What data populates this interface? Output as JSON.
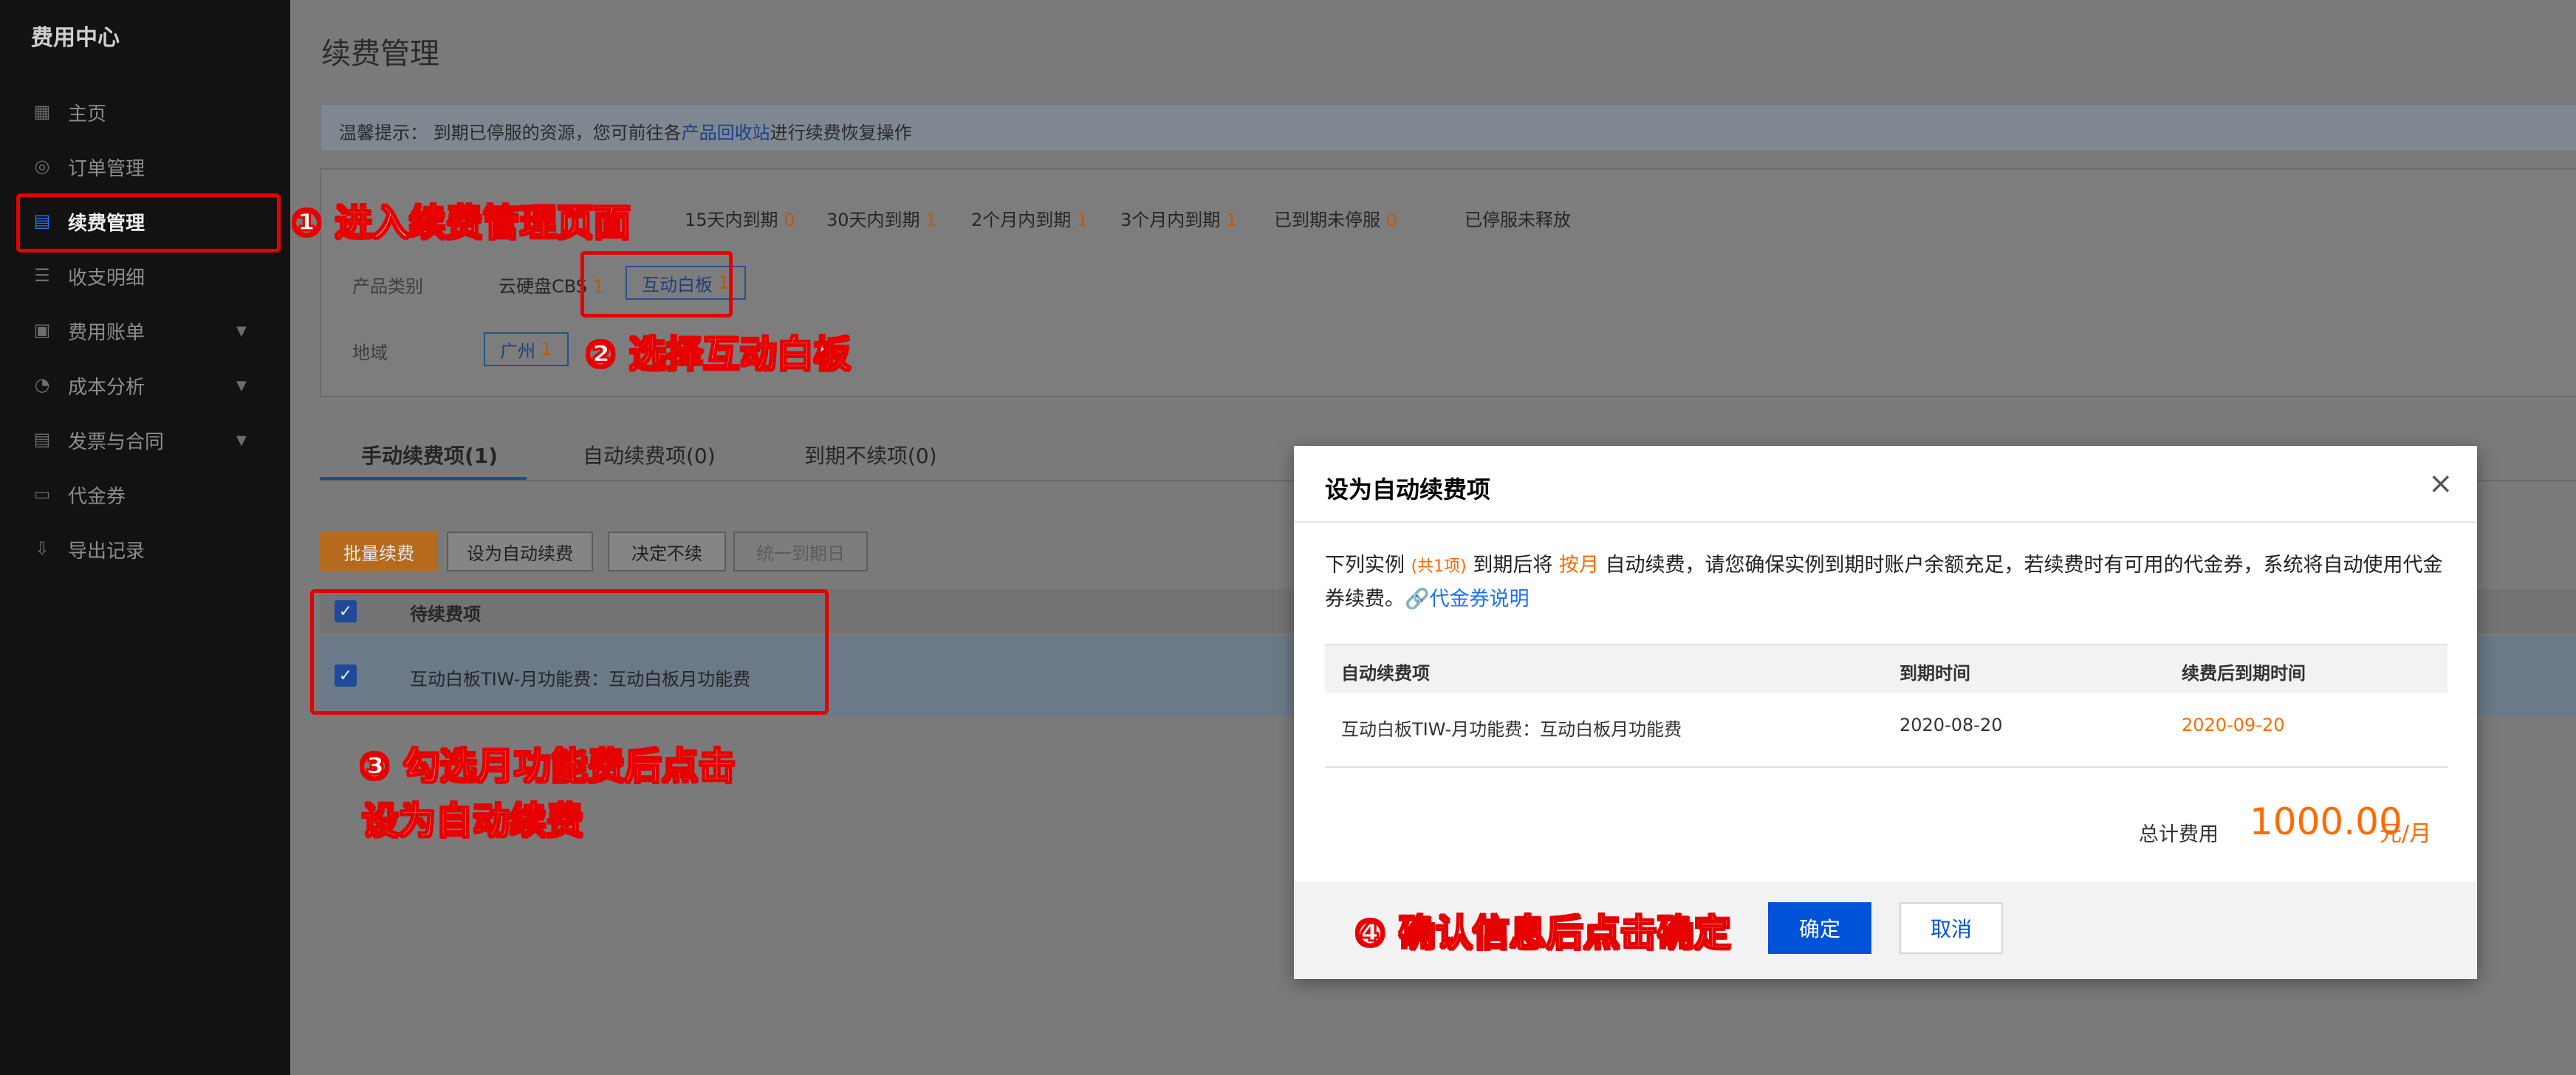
{
  "sidebar": {
    "brand": "费用中心",
    "items": [
      {
        "label": "主页",
        "icon": "grid-icon"
      },
      {
        "label": "订单管理",
        "icon": "coin-icon"
      },
      {
        "label": "续费管理",
        "icon": "renew-icon",
        "active": true
      },
      {
        "label": "收支明细",
        "icon": "list-icon"
      },
      {
        "label": "费用账单",
        "icon": "bill-icon",
        "has_submenu": true
      },
      {
        "label": "成本分析",
        "icon": "pie-icon",
        "has_submenu": true
      },
      {
        "label": "发票与合同",
        "icon": "invoice-icon",
        "has_submenu": true
      },
      {
        "label": "代金券",
        "icon": "voucher-icon"
      },
      {
        "label": "导出记录",
        "icon": "export-icon"
      }
    ]
  },
  "main": {
    "title": "续费管理",
    "tip": {
      "prefix": "温馨提示： 到期已停服的资源，您可前往各",
      "link": "产品回收站",
      "suffix": "进行续费恢复操作"
    },
    "expiry_filters": [
      {
        "label": "15天内到期",
        "count": "0"
      },
      {
        "label": "30天内到期",
        "count": "1"
      },
      {
        "label": "2个月内到期",
        "count": "1"
      },
      {
        "label": "3个月内到期",
        "count": "1"
      },
      {
        "label": "已到期未停服",
        "count": "0"
      },
      {
        "label": "已停服未释放",
        "count": ""
      }
    ],
    "product_label": "产品类别",
    "products": [
      {
        "label": "云硬盘CBS",
        "count": "1"
      },
      {
        "label": "互动白板",
        "count": "1"
      }
    ],
    "region_label": "地域",
    "region": {
      "label": "广州",
      "count": "1"
    },
    "tabs": [
      "手动续费项(1)",
      "自动续费项(0)",
      "到期不续项(0)"
    ],
    "actions": {
      "batch": "批量续费",
      "set_auto": "设为自动续费",
      "no_renew": "决定不续",
      "unify": "统一到期日"
    },
    "table": {
      "header": "待续费项",
      "row": "互动白板TIW-月功能费：互动白板月功能费"
    }
  },
  "annotations": {
    "step1": "① 进入续费管理页面",
    "step2": "② 选择互动白板",
    "step3_line1": "③ 勾选月功能费后点击",
    "step3_line2": "设为自动续费",
    "step4": "④ 确认信息后点击确定"
  },
  "modal": {
    "title": "设为自动续费项",
    "close": "×",
    "desc_a": "下列实例",
    "desc_count": "(共1项)",
    "desc_b": "到期后将",
    "desc_cycle": "按月",
    "desc_c": "自动续费，请您确保实例到期时账户余额充足，若续费时有可用的代金券，系统将自动使用代金券续费。",
    "desc_link": "代金券说明",
    "columns": [
      "自动续费项",
      "到期时间",
      "续费后到期时间"
    ],
    "row": {
      "item": "互动白板TIW-月功能费：互动白板月功能费",
      "expire": "2020-08-20",
      "renewed": "2020-09-20"
    },
    "total_label": "总计费用",
    "total": "1000.00",
    "unit": "元/月",
    "ok": "确定",
    "cancel": "取消"
  },
  "colors": {
    "accent": "#0052d9",
    "price": "#ff6a00",
    "annotation": "#e60000",
    "sidebar_bg": "#121212"
  }
}
